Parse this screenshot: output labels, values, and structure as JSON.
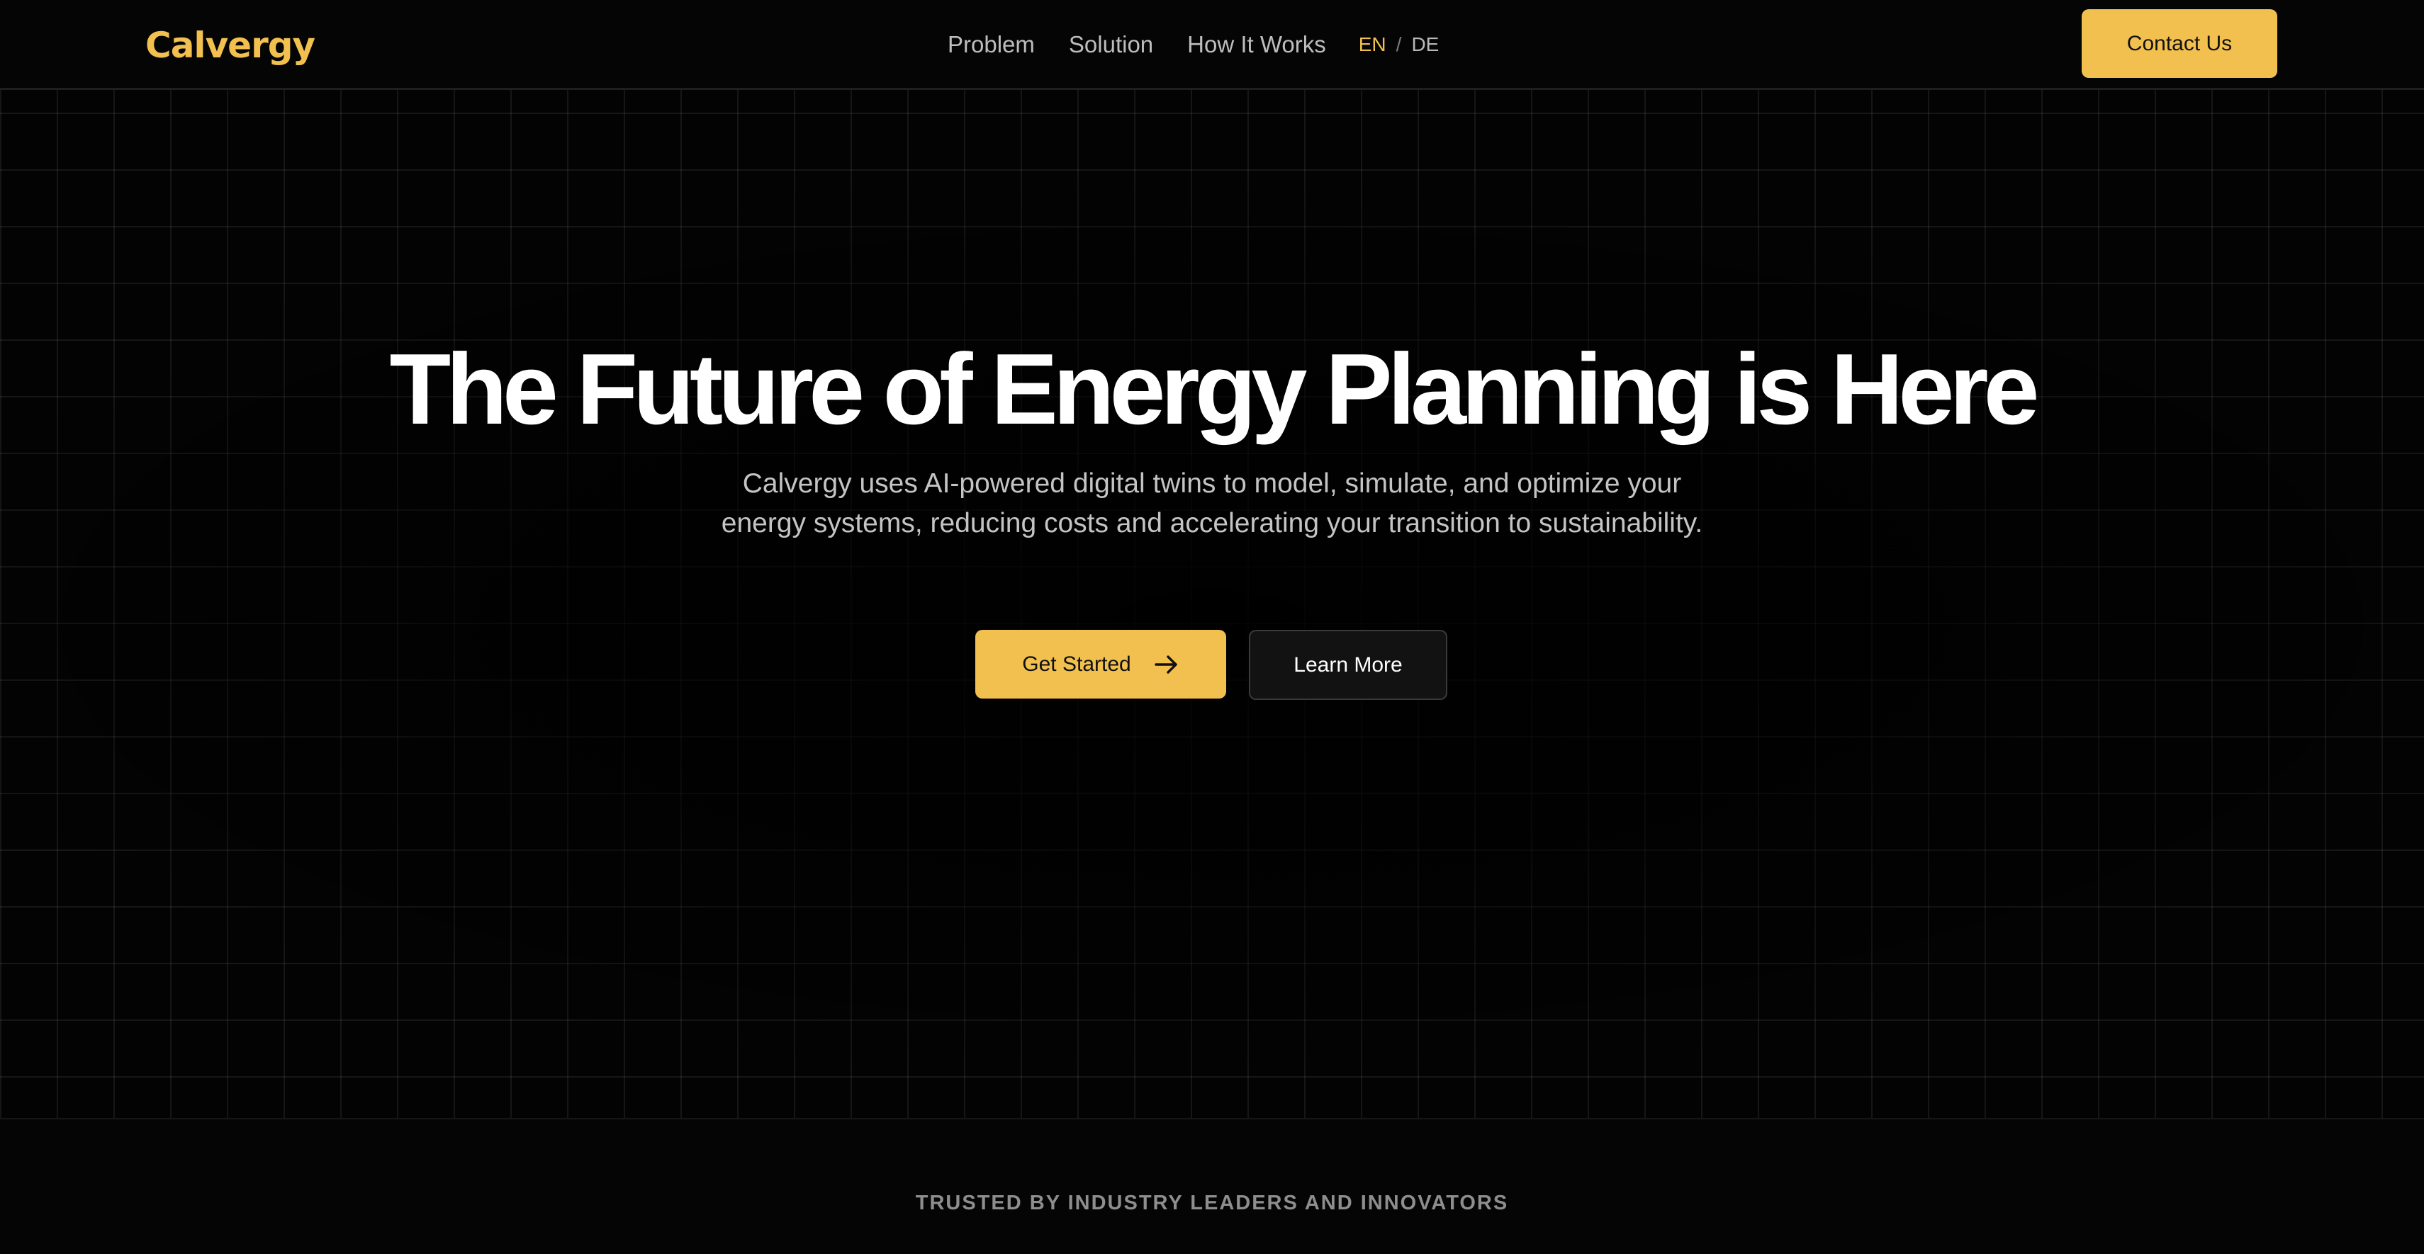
{
  "brand": {
    "name": "Calvergy",
    "accent_color": "#f2c04f"
  },
  "nav": {
    "links": [
      "Problem",
      "Solution",
      "How It Works"
    ],
    "language": {
      "active": "EN",
      "separator": "/",
      "other": "DE"
    },
    "contact_label": "Contact Us"
  },
  "hero": {
    "title": "The Future of Energy Planning is Here",
    "subtitle": "Calvergy uses AI-powered digital twins to model, simulate, and optimize your energy systems, reducing costs and accelerating your transition to sustainability.",
    "primary_cta": {
      "label": "Get Started",
      "icon": "arrow-right-icon"
    },
    "secondary_cta": {
      "label": "Learn More"
    }
  },
  "trusted": {
    "label": "TRUSTED BY INDUSTRY LEADERS AND INNOVATORS"
  }
}
